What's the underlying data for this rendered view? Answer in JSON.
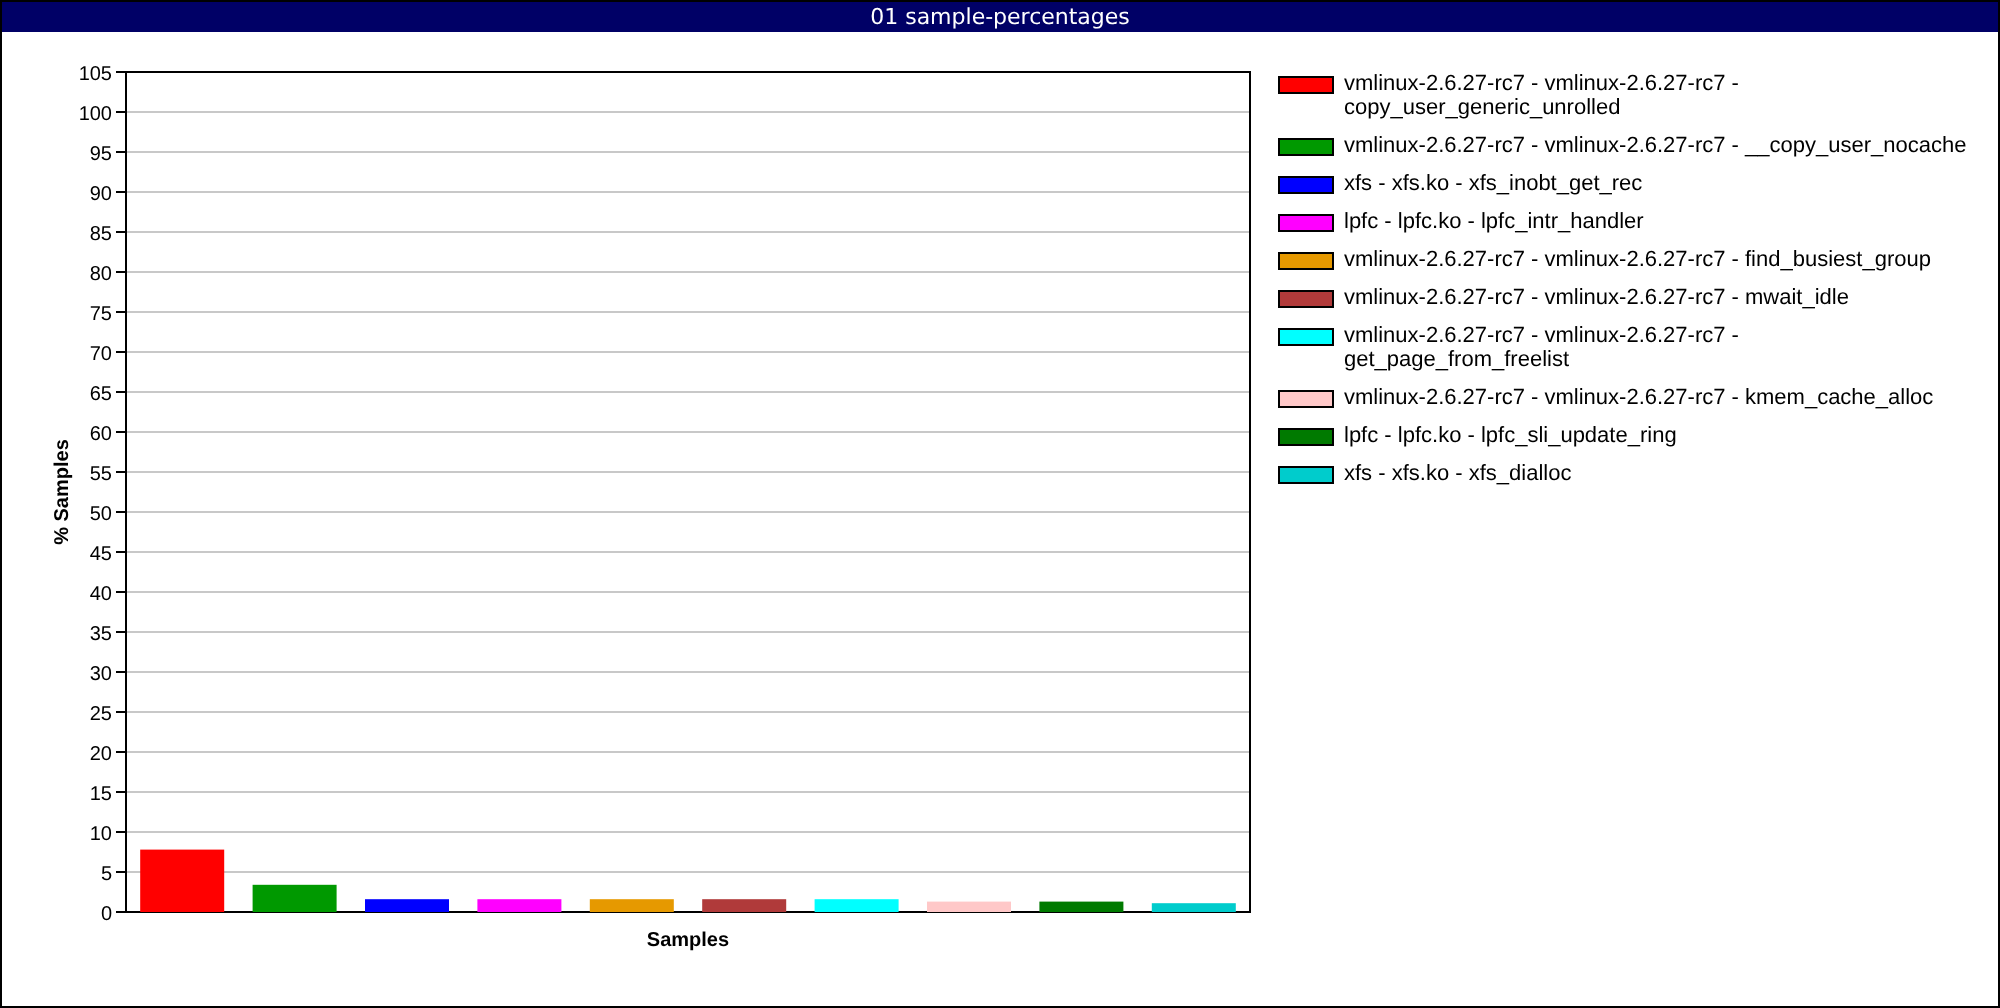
{
  "window": {
    "title": "01 sample-percentages"
  },
  "chart": {
    "chart_data": {
      "type": "bar",
      "xlabel": "Samples",
      "ylabel": "% Samples",
      "grid": true,
      "ylim": [
        0,
        105
      ],
      "yticks": [
        0,
        5,
        10,
        15,
        20,
        25,
        30,
        35,
        40,
        45,
        50,
        55,
        60,
        65,
        70,
        75,
        80,
        85,
        90,
        95,
        100,
        105
      ],
      "series": [
        {
          "name": "vmlinux-2.6.27-rc7 - vmlinux-2.6.27-rc7 - copy_user_generic_unrolled",
          "color": "#ff0000",
          "values": [
            7.8
          ]
        },
        {
          "name": "vmlinux-2.6.27-rc7 - vmlinux-2.6.27-rc7 - __copy_user_nocache",
          "color": "#009900",
          "values": [
            3.4
          ]
        },
        {
          "name": "xfs - xfs.ko - xfs_inobt_get_rec",
          "color": "#0000ff",
          "values": [
            1.6
          ]
        },
        {
          "name": "lpfc - lpfc.ko - lpfc_intr_handler",
          "color": "#ff00ff",
          "values": [
            1.6
          ]
        },
        {
          "name": "vmlinux-2.6.27-rc7 - vmlinux-2.6.27-rc7 - find_busiest_group",
          "color": "#e69900",
          "values": [
            1.6
          ]
        },
        {
          "name": "vmlinux-2.6.27-rc7 - vmlinux-2.6.27-rc7 - mwait_idle",
          "color": "#b03a3a",
          "values": [
            1.6
          ]
        },
        {
          "name": "vmlinux-2.6.27-rc7 - vmlinux-2.6.27-rc7 - get_page_from_freelist",
          "color": "#00ffff",
          "values": [
            1.6
          ]
        },
        {
          "name": "vmlinux-2.6.27-rc7 - vmlinux-2.6.27-rc7 - kmem_cache_alloc",
          "color": "#ffc8c8",
          "values": [
            1.3
          ]
        },
        {
          "name": "lpfc - lpfc.ko - lpfc_sli_update_ring",
          "color": "#007a00",
          "values": [
            1.3
          ]
        },
        {
          "name": "xfs - xfs.ko - xfs_dialloc",
          "color": "#00cccc",
          "values": [
            1.1
          ]
        }
      ]
    }
  }
}
